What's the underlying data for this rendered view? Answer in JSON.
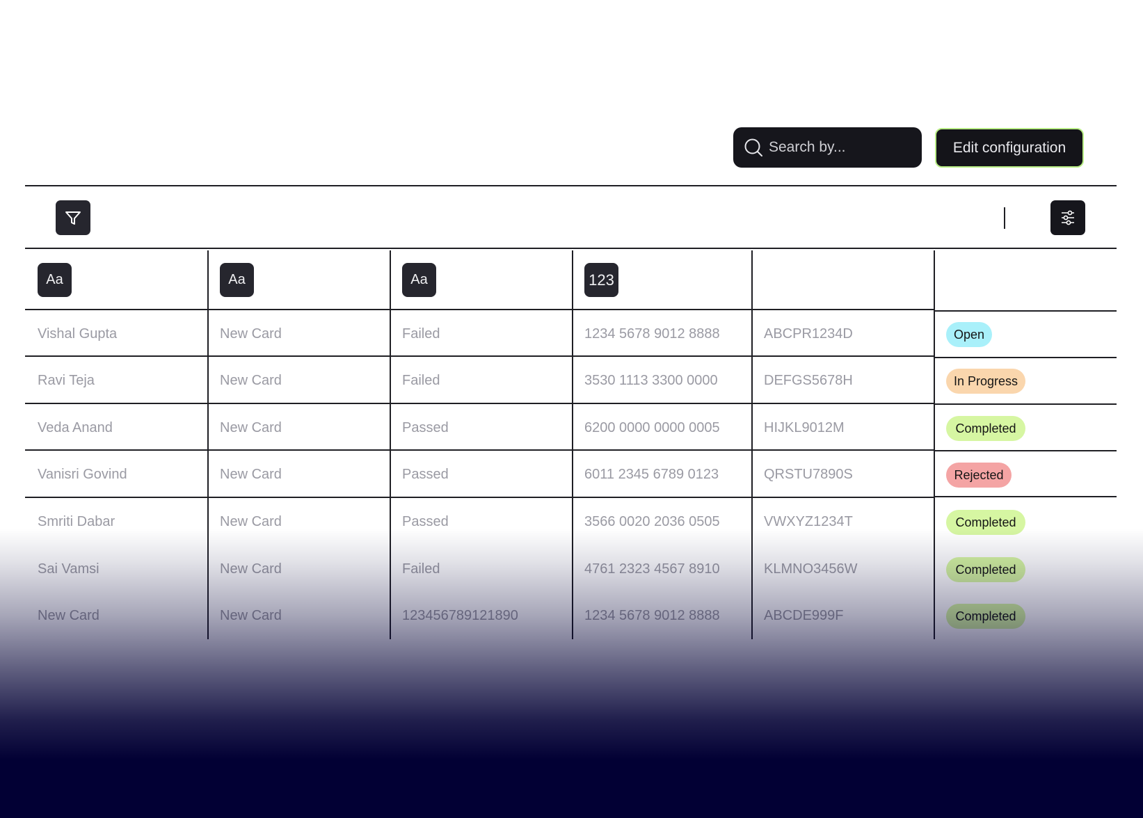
{
  "toolbar": {
    "search_placeholder": "Search by...",
    "edit_configuration_label": "Edit configuration"
  },
  "icons": {
    "search": "search-icon",
    "filter": "filter-icon",
    "settings": "sliders-icon"
  },
  "columns": [
    {
      "type_label": "Aa"
    },
    {
      "type_label": "Aa"
    },
    {
      "type_label": "Aa"
    },
    {
      "type_label": "123"
    },
    {
      "type_label": ""
    },
    {
      "type_label": ""
    }
  ],
  "rows": [
    {
      "name": "Vishal Gupta",
      "type": "New Card",
      "check": "Failed",
      "number": "1234 5678 9012 8888",
      "code": "ABCPR1234D",
      "status": "Open",
      "status_color": "#a9f0fa"
    },
    {
      "name": "Ravi Teja",
      "type": "New Card",
      "check": "Failed",
      "number": "3530 1113 3300 0000",
      "code": "DEFGS5678H",
      "status": "In Progress",
      "status_color": "#fad6ad"
    },
    {
      "name": "Veda Anand",
      "type": "New Card",
      "check": "Passed",
      "number": "6200 0000 0000 0005",
      "code": "HIJKL9012M",
      "status": "Completed",
      "status_color": "#d6f6a2"
    },
    {
      "name": "Vanisri Govind",
      "type": "New Card",
      "check": "Passed",
      "number": "6011 2345 6789 0123",
      "code": "QRSTU7890S",
      "status": "Rejected",
      "status_color": "#f4a4a4"
    },
    {
      "name": "Smriti Dabar",
      "type": "New Card",
      "check": "Passed",
      "number": "3566 0020 2036 0505",
      "code": "VWXYZ1234T",
      "status": "Completed",
      "status_color": "#d6f6a2"
    },
    {
      "name": "Sai Vamsi",
      "type": "New Card",
      "check": "Failed",
      "number": "4761 2323 4567 8910",
      "code": "KLMNO3456W",
      "status": "Completed",
      "status_color": "#d6f6a2"
    },
    {
      "name": "New Card",
      "type": "New Card",
      "check": "123456789121890",
      "number": "1234 5678 9012 8888",
      "code": "ABCDE999F",
      "status": "Completed",
      "status_color": "#d6f6a2"
    }
  ],
  "colors": {
    "accent_border": "#b9ee86",
    "dark_surface": "#16161c",
    "bottom_gradient": "#020034"
  }
}
